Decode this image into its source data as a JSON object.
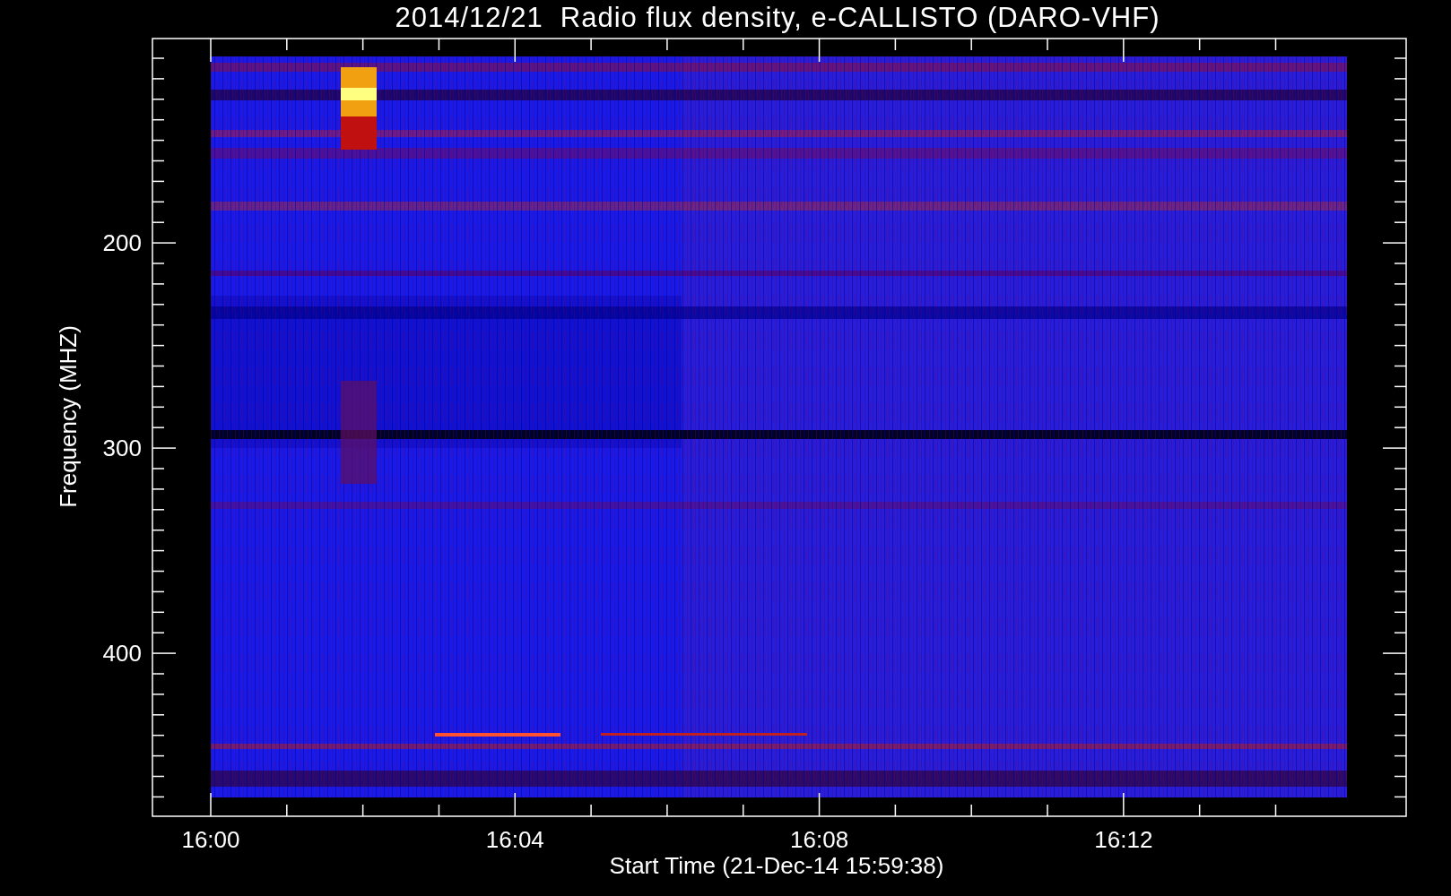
{
  "plot": {
    "title": "2014/12/21  Radio flux density, e-CALLISTO (DARO-VHF)",
    "ylabel": "Frequency (MHZ)",
    "xlabel": "Start Time (21-Dec-14 15:59:38)",
    "yticks": [
      "200",
      "300",
      "400"
    ],
    "xticks": [
      "16:00",
      "16:04",
      "16:08",
      "16:12"
    ]
  }
}
